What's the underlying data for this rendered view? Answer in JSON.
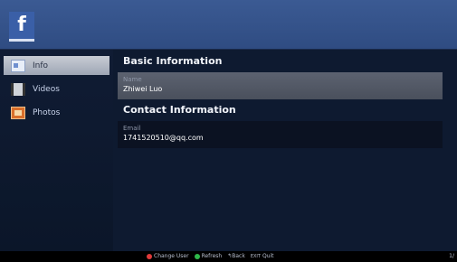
{
  "header": {
    "logo_letter": "f"
  },
  "sidebar": {
    "items": [
      {
        "label": "Info",
        "icon": "info-icon",
        "active": true
      },
      {
        "label": "Videos",
        "icon": "video-icon",
        "active": false
      },
      {
        "label": "Photos",
        "icon": "photo-icon",
        "active": false
      }
    ]
  },
  "main": {
    "basic_title": "Basic Information",
    "name_label": "Name",
    "name_value": "Zhiwei Luo",
    "contact_title": "Contact Information",
    "email_label": "Email",
    "email_value": "1741520510@qq.com"
  },
  "footer": {
    "change_user": "Change User",
    "refresh": "Refresh",
    "back_glyph": "↰",
    "back": "Back",
    "exit_key": "EXIT",
    "quit": "Quit",
    "page": "1/"
  },
  "colors": {
    "header": "#2f4c82",
    "background": "#0e1a30",
    "red_key": "#e03a3a",
    "green_key": "#2fb84a"
  }
}
